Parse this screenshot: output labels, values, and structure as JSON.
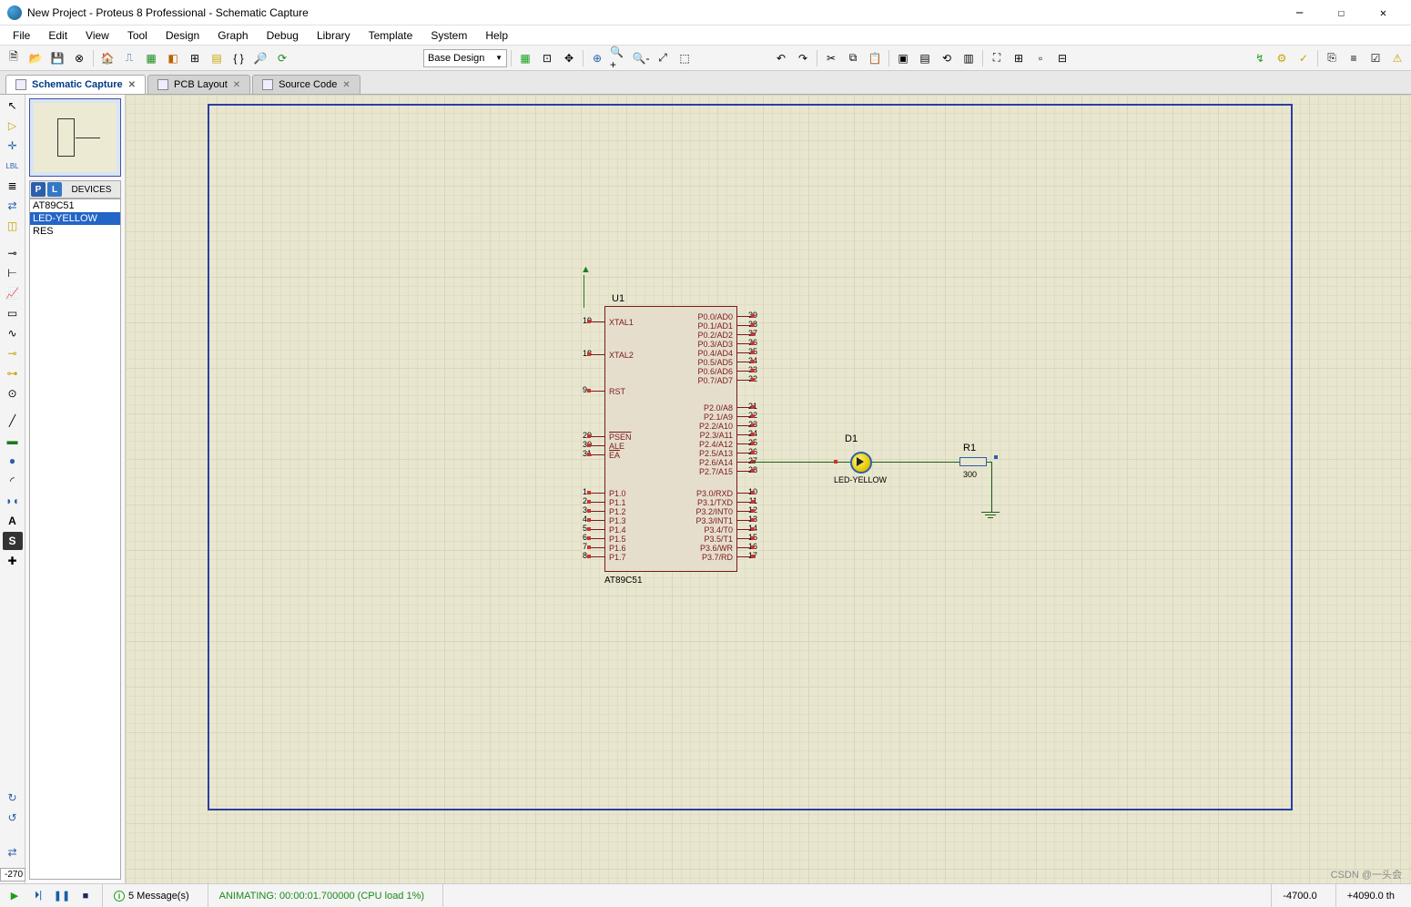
{
  "window": {
    "title": "New Project - Proteus 8 Professional - Schematic Capture"
  },
  "menu": [
    "File",
    "Edit",
    "View",
    "Tool",
    "Design",
    "Graph",
    "Debug",
    "Library",
    "Template",
    "System",
    "Help"
  ],
  "toolbar": {
    "combo_design": "Base Design"
  },
  "tabs": [
    {
      "label": "Schematic Capture",
      "active": true
    },
    {
      "label": "PCB Layout",
      "active": false
    },
    {
      "label": "Source Code",
      "active": false
    }
  ],
  "picker": {
    "header": "DEVICES",
    "items": [
      "AT89C51",
      "LED-YELLOW",
      "RES"
    ],
    "selected": 1
  },
  "coord_box": "-270",
  "schematic": {
    "u1": {
      "ref": "U1",
      "value": "AT89C51",
      "left_groups": [
        [
          {
            "num": "19",
            "name": "XTAL1"
          }
        ],
        [
          {
            "num": "18",
            "name": "XTAL2"
          }
        ],
        [
          {
            "num": "9",
            "name": "RST"
          }
        ],
        [
          {
            "num": "29",
            "name": "PSEN",
            "ol": true
          },
          {
            "num": "30",
            "name": "ALE"
          },
          {
            "num": "31",
            "name": "EA",
            "ol": true
          }
        ],
        [
          {
            "num": "1",
            "name": "P1.0"
          },
          {
            "num": "2",
            "name": "P1.1"
          },
          {
            "num": "3",
            "name": "P1.2"
          },
          {
            "num": "4",
            "name": "P1.3"
          },
          {
            "num": "5",
            "name": "P1.4"
          },
          {
            "num": "6",
            "name": "P1.5"
          },
          {
            "num": "7",
            "name": "P1.6"
          },
          {
            "num": "8",
            "name": "P1.7"
          }
        ]
      ],
      "right_groups": [
        [
          {
            "num": "39",
            "name": "P0.0/AD0"
          },
          {
            "num": "38",
            "name": "P0.1/AD1"
          },
          {
            "num": "37",
            "name": "P0.2/AD2"
          },
          {
            "num": "36",
            "name": "P0.3/AD3"
          },
          {
            "num": "35",
            "name": "P0.4/AD4"
          },
          {
            "num": "34",
            "name": "P0.5/AD5"
          },
          {
            "num": "33",
            "name": "P0.6/AD6"
          },
          {
            "num": "32",
            "name": "P0.7/AD7"
          }
        ],
        [
          {
            "num": "21",
            "name": "P2.0/A8"
          },
          {
            "num": "22",
            "name": "P2.1/A9"
          },
          {
            "num": "23",
            "name": "P2.2/A10"
          },
          {
            "num": "24",
            "name": "P2.3/A11"
          },
          {
            "num": "25",
            "name": "P2.4/A12"
          },
          {
            "num": "26",
            "name": "P2.5/A13"
          },
          {
            "num": "27",
            "name": "P2.6/A14"
          },
          {
            "num": "28",
            "name": "P2.7/A15"
          }
        ],
        [
          {
            "num": "10",
            "name": "P3.0/RXD"
          },
          {
            "num": "11",
            "name": "P3.1/TXD"
          },
          {
            "num": "12",
            "name": "P3.2/INT0"
          },
          {
            "num": "13",
            "name": "P3.3/INT1"
          },
          {
            "num": "14",
            "name": "P3.4/T0"
          },
          {
            "num": "15",
            "name": "P3.5/T1"
          },
          {
            "num": "16",
            "name": "P3.6/WR"
          },
          {
            "num": "17",
            "name": "P3.7/RD"
          }
        ]
      ]
    },
    "d1": {
      "ref": "D1",
      "value": "LED-YELLOW"
    },
    "r1": {
      "ref": "R1",
      "value": "300"
    }
  },
  "status": {
    "messages": "5 Message(s)",
    "animating": "ANIMATING: 00:00:01.700000 (CPU load 1%)",
    "coord_x": "-4700.0",
    "coord_y": "+4090.0 th"
  },
  "watermark": "CSDN @一头会"
}
